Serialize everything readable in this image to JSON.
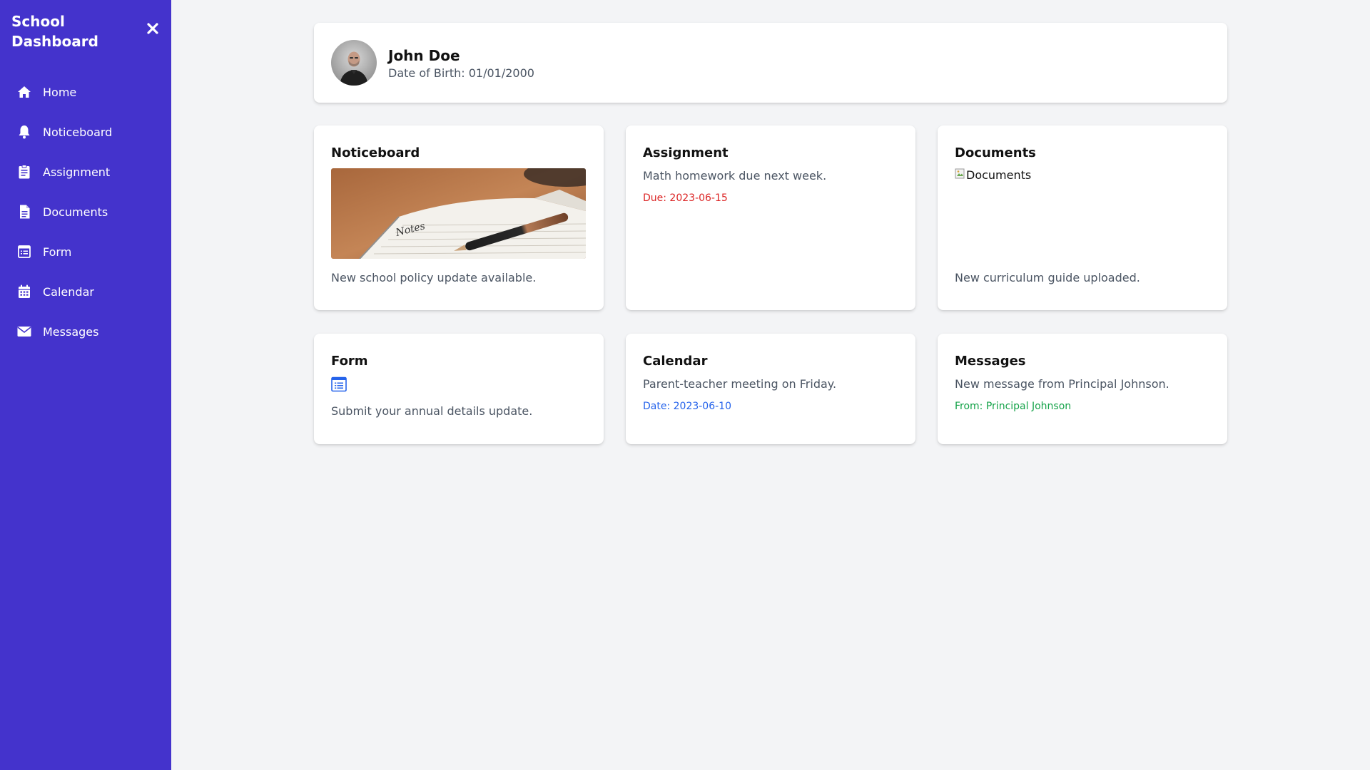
{
  "sidebar": {
    "title": "School Dashboard",
    "close_icon": "close-icon",
    "items": [
      {
        "label": "Home",
        "icon": "home-icon"
      },
      {
        "label": "Noticeboard",
        "icon": "bell-icon"
      },
      {
        "label": "Assignment",
        "icon": "clipboard-icon"
      },
      {
        "label": "Documents",
        "icon": "document-icon"
      },
      {
        "label": "Form",
        "icon": "form-icon"
      },
      {
        "label": "Calendar",
        "icon": "calendar-icon"
      },
      {
        "label": "Messages",
        "icon": "envelope-icon"
      }
    ]
  },
  "profile": {
    "name": "John Doe",
    "dob": "Date of Birth: 01/01/2000"
  },
  "cards": {
    "noticeboard": {
      "title": "Noticeboard",
      "text": "New school policy update available.",
      "image_label": "Notes"
    },
    "assignment": {
      "title": "Assignment",
      "text": "Math homework due next week.",
      "meta": "Due: 2023-06-15"
    },
    "documents": {
      "title": "Documents",
      "image_alt": "Documents",
      "text": "New curriculum guide uploaded."
    },
    "form": {
      "title": "Form",
      "text": "Submit your annual details update."
    },
    "calendar": {
      "title": "Calendar",
      "text": "Parent-teacher meeting on Friday.",
      "meta": "Date: 2023-06-10"
    },
    "messages": {
      "title": "Messages",
      "text": "New message from Principal Johnson.",
      "meta": "From: Principal Johnson"
    }
  },
  "colors": {
    "sidebar_bg": "#4433cc",
    "background": "#f3f4f6",
    "due_red": "#dc2626",
    "date_blue": "#2563eb",
    "from_green": "#16a34a",
    "form_icon_blue": "#2563eb"
  }
}
